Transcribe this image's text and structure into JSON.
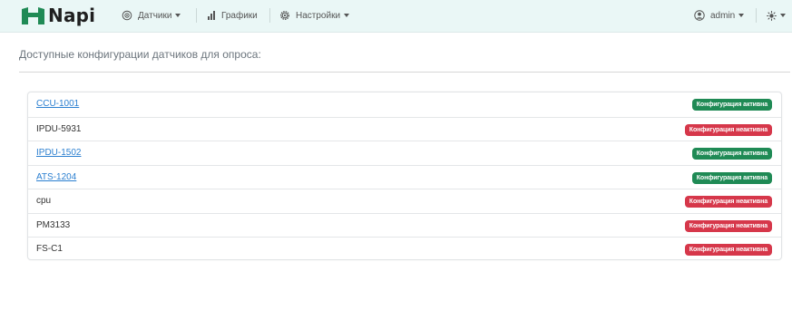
{
  "navbar": {
    "brand_name": "Napi",
    "brand_color": "#1f8a55",
    "menu": [
      {
        "label": "Датчики",
        "icon": "radio-icon",
        "has_dropdown": true
      },
      {
        "label": "Графики",
        "icon": "bar-chart-icon",
        "has_dropdown": false
      },
      {
        "label": "Настройки",
        "icon": "gear-icon",
        "has_dropdown": true
      }
    ],
    "user": {
      "label": "admin",
      "icon": "user-circle-icon",
      "has_dropdown": true
    },
    "theme_toggle": {
      "icon": "sun-icon",
      "has_dropdown": true
    }
  },
  "main": {
    "heading": "Доступные конфигурации датчиков для опроса:",
    "configs": [
      {
        "name": "CCU-1001",
        "is_link": true,
        "status": "Конфигурация активна",
        "state": "active"
      },
      {
        "name": "IPDU-5931",
        "is_link": false,
        "status": "Конфигурация неактивна",
        "state": "inactive"
      },
      {
        "name": "IPDU-1502",
        "is_link": true,
        "status": "Конфигурация активна",
        "state": "active"
      },
      {
        "name": "ATS-1204",
        "is_link": true,
        "status": "Конфигурация активна",
        "state": "active"
      },
      {
        "name": "cpu",
        "is_link": false,
        "status": "Конфигурация неактивна",
        "state": "inactive"
      },
      {
        "name": "PM3133",
        "is_link": false,
        "status": "Конфигурация неактивна",
        "state": "inactive"
      },
      {
        "name": "FS-C1",
        "is_link": false,
        "status": "Конфигурация неактивна",
        "state": "inactive"
      }
    ]
  },
  "colors": {
    "navbar_bg": "#eaf7f6",
    "active": "#1f8a55",
    "inactive": "#d6374a",
    "link": "#2b7fd0"
  }
}
